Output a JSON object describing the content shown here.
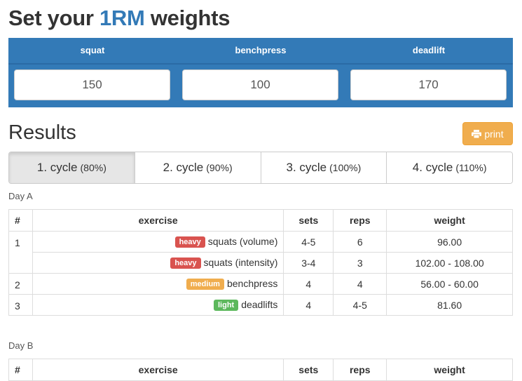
{
  "page": {
    "title_prefix": "Set your",
    "title_accent": "1RM",
    "title_suffix": "weights"
  },
  "rm": {
    "columns": [
      {
        "label": "squat",
        "value": "150"
      },
      {
        "label": "benchpress",
        "value": "100"
      },
      {
        "label": "deadlift",
        "value": "170"
      }
    ]
  },
  "results": {
    "title": "Results",
    "print_label": "print",
    "print_icon": "printer-icon"
  },
  "cycles": [
    {
      "label": "1. cycle",
      "pct": "(80%)",
      "active": true
    },
    {
      "label": "2. cycle",
      "pct": "(90%)",
      "active": false
    },
    {
      "label": "3. cycle",
      "pct": "(100%)",
      "active": false
    },
    {
      "label": "4. cycle",
      "pct": "(110%)",
      "active": false
    }
  ],
  "colors": {
    "primary": "#337ab7",
    "heavy": "#d9534f",
    "medium": "#f0ad4e",
    "light": "#5cb85c"
  },
  "table_headers": {
    "num": "#",
    "exercise": "exercise",
    "sets": "sets",
    "reps": "reps",
    "weight": "weight"
  },
  "day_a": {
    "label": "Day A",
    "rows": [
      {
        "num": "1",
        "badge": "heavy",
        "exercise": "squats (volume)",
        "sets": "4-5",
        "reps": "6",
        "weight": "96.00"
      },
      {
        "num": "",
        "badge": "heavy",
        "exercise": "squats (intensity)",
        "sets": "3-4",
        "reps": "3",
        "weight": "102.00 - 108.00"
      },
      {
        "num": "2",
        "badge": "medium",
        "exercise": "benchpress",
        "sets": "4",
        "reps": "4",
        "weight": "56.00 - 60.00"
      },
      {
        "num": "3",
        "badge": "light",
        "exercise": "deadlifts",
        "sets": "4",
        "reps": "4-5",
        "weight": "81.60"
      }
    ]
  },
  "day_b": {
    "label": "Day B"
  }
}
